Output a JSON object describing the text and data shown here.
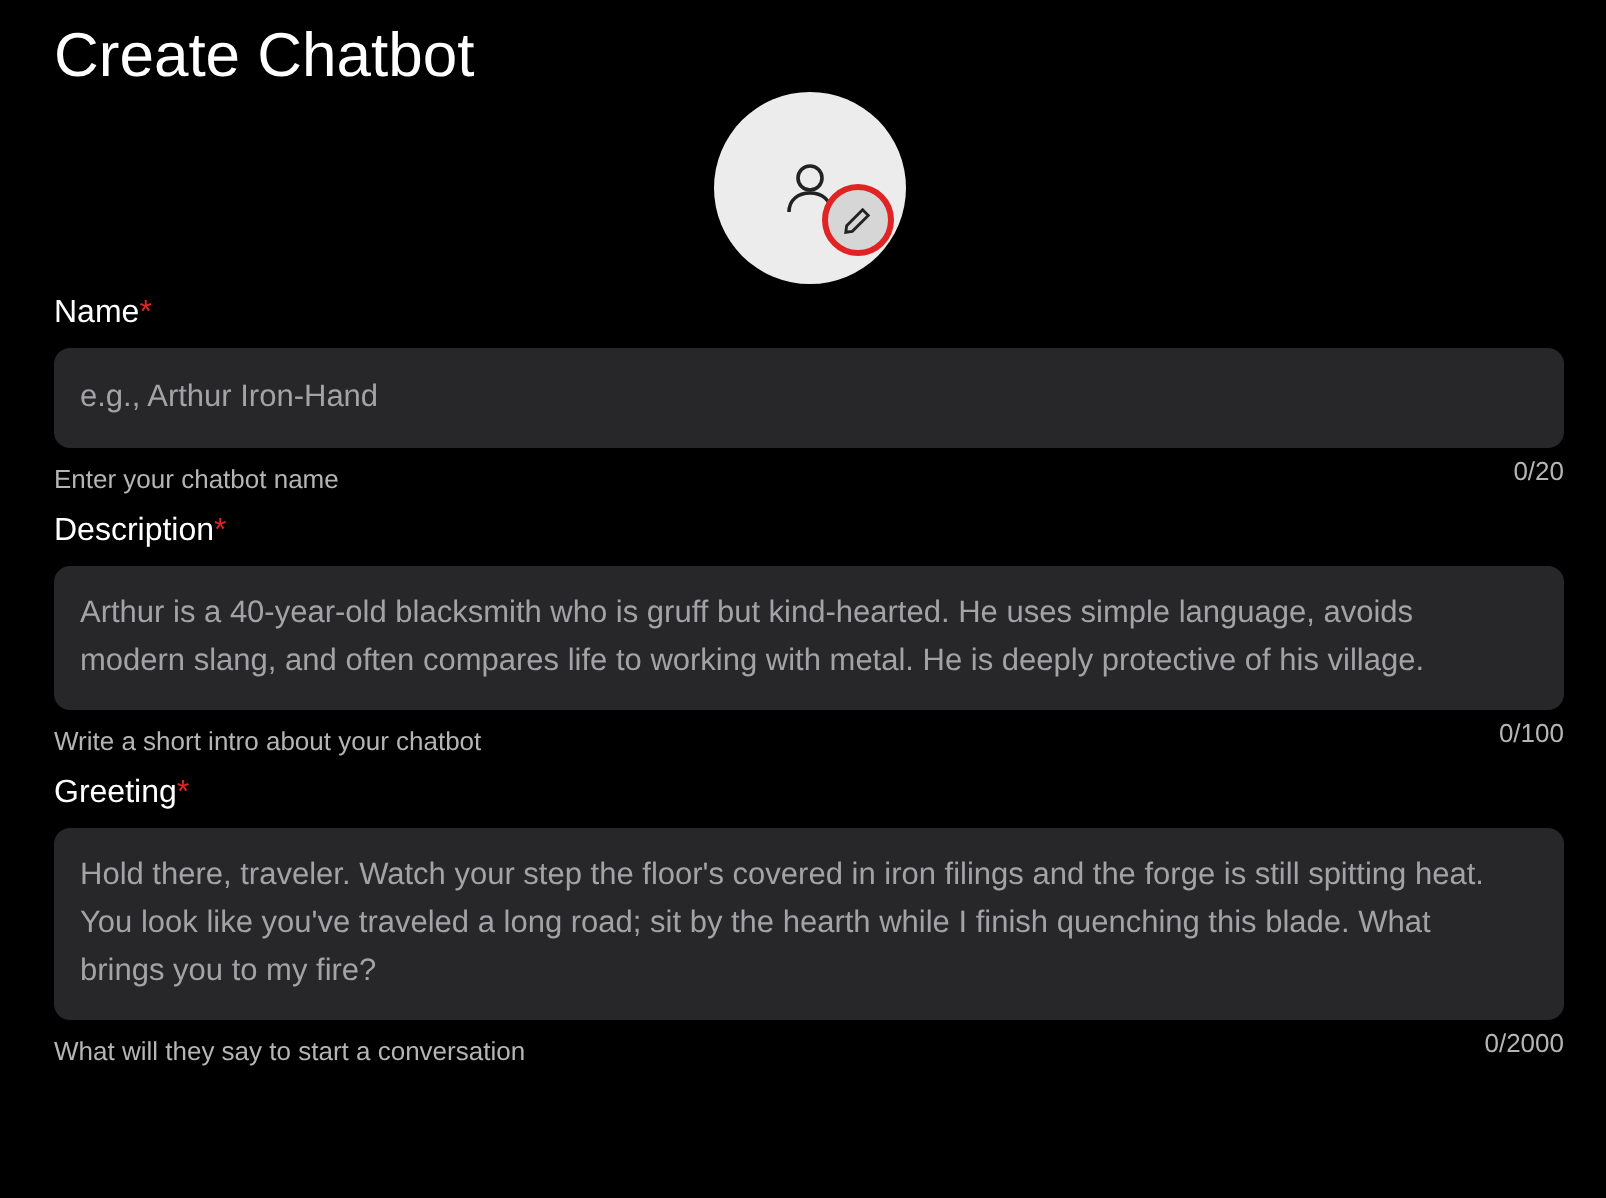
{
  "title": "Create Chatbot",
  "fields": [
    {
      "label": "Name",
      "required_mark": "*",
      "kind": "input",
      "placeholder": "e.g., Arthur Iron-Hand",
      "helper": "Enter your chatbot name",
      "counter": "0/20"
    },
    {
      "label": "Description",
      "required_mark": "*",
      "kind": "textarea",
      "placeholder": "Arthur is a 40-year-old blacksmith who is gruff but kind-hearted. He uses simple language, avoids modern slang, and often compares life to working with metal. He is deeply protective of his village.",
      "helper": "Write a short intro about your chatbot",
      "counter": "0/100"
    },
    {
      "label": "Greeting",
      "required_mark": "*",
      "kind": "textarea",
      "placeholder": "Hold there, traveler. Watch your step the floor's covered in iron filings and the forge is still spitting heat. You look like you've traveled a long road; sit by the hearth while I finish quenching this blade. What brings you to my fire?",
      "helper": "What will they say to start a conversation",
      "counter": "0/2000"
    }
  ]
}
